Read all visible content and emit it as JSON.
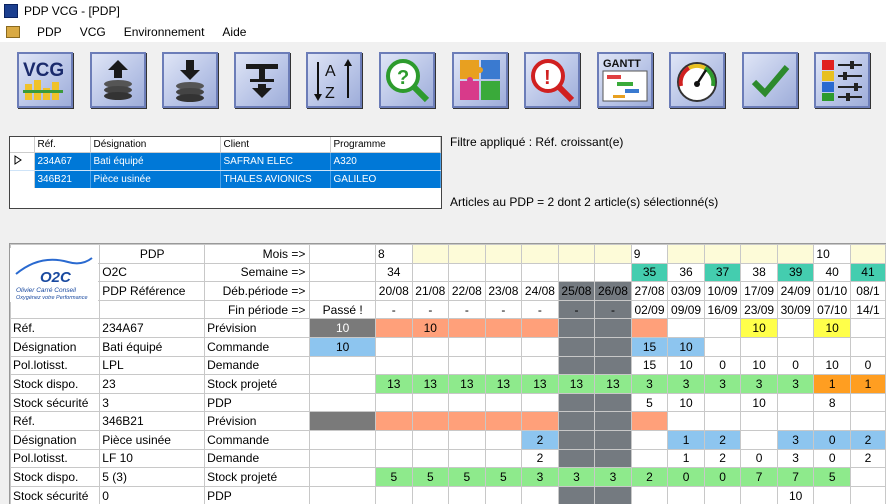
{
  "window": {
    "title": "PDP VCG - [PDP]"
  },
  "menu": [
    "PDP",
    "VCG",
    "Environnement",
    "Aide"
  ],
  "toolbar": [
    {
      "name": "vcg-button",
      "icon": "vcg-logo"
    },
    {
      "name": "stack-up-button",
      "icon": "stack-arrow-up-icon"
    },
    {
      "name": "stack-down-button",
      "icon": "stack-arrow-down-icon"
    },
    {
      "name": "split-arrow-button",
      "icon": "split-arrow-icon"
    },
    {
      "name": "sort-az-button",
      "icon": "sort-az-icon"
    },
    {
      "name": "help-search-button",
      "icon": "question-magnifier-icon"
    },
    {
      "name": "puzzle-button",
      "icon": "puzzle-icon"
    },
    {
      "name": "alert-search-button",
      "icon": "exclamation-magnifier-icon"
    },
    {
      "name": "gantt-button",
      "icon": "gantt-icon",
      "label": "GANTT"
    },
    {
      "name": "gauge-button",
      "icon": "gauge-icon"
    },
    {
      "name": "validate-button",
      "icon": "checkmark-icon"
    },
    {
      "name": "settings-button",
      "icon": "sliders-icon"
    }
  ],
  "articles": {
    "columns": [
      "Réf.",
      "Désignation",
      "Client",
      "Programme"
    ],
    "rows": [
      {
        "ref": "234A67",
        "designation": "Bati équipé",
        "client": "SAFRAN ELEC",
        "programme": "A320"
      },
      {
        "ref": "346B21",
        "designation": "Pièce usinée",
        "client": "THALES AVIONICS",
        "programme": "GALILEO"
      }
    ]
  },
  "filter_label": "Filtre appliqué : Réf. croissant(e)",
  "count_label": "Articles au PDP = 2 dont 2 article(s) sélectionné(s)",
  "logo": {
    "text": "O2C",
    "tagline1": "Olivier Carré Conseil",
    "tagline2": "Oxygénez votre Performance"
  },
  "grid": {
    "head": {
      "pdp": "PDP",
      "o2c": "O2C",
      "pdp_ref": "PDP Référence",
      "mois_lbl": "Mois =>",
      "semaine_lbl": "Semaine =>",
      "deb_lbl": "Déb.période =>",
      "fin_lbl": "Fin période =>",
      "passe": "Passé !",
      "mois": [
        "8",
        "",
        "",
        "",
        "",
        "",
        "",
        "9",
        "",
        "",
        "",
        "",
        "10",
        ""
      ],
      "semaine": [
        "34",
        "",
        "",
        "",
        "",
        "",
        "",
        "35",
        "36",
        "37",
        "38",
        "39",
        "40",
        "41"
      ],
      "deb": [
        "20/08",
        "21/08",
        "22/08",
        "23/08",
        "24/08",
        "25/08",
        "26/08",
        "27/08",
        "03/09",
        "10/09",
        "17/09",
        "24/09",
        "01/10",
        "08/1"
      ],
      "fin": [
        "-",
        "-",
        "-",
        "-",
        "-",
        "-",
        "-",
        "02/09",
        "09/09",
        "16/09",
        "23/09",
        "30/09",
        "07/10",
        "14/1"
      ]
    },
    "articles": [
      {
        "ref_lbl": "Réf.",
        "ref": "234A67",
        "desig_lbl": "Désignation",
        "desig": "Bati équipé",
        "pol_lbl": "Pol.lotisst.",
        "pol": "LPL",
        "stock_lbl": "Stock dispo.",
        "stock": "23",
        "secu_lbl": "Stock sécurité",
        "secu": "3",
        "prevision_lbl": "Prévision",
        "commande_lbl": "Commande",
        "demande_lbl": "Demande",
        "projete_lbl": "Stock projeté",
        "pdp_lbl": "PDP",
        "prevision": {
          "passe": "10",
          "v": [
            "",
            "10",
            "",
            "",
            "",
            "",
            "",
            "",
            "",
            "",
            "10",
            "",
            "10",
            ""
          ]
        },
        "commande": {
          "passe": "10",
          "v": [
            "",
            "",
            "",
            "",
            "",
            "",
            "",
            "15",
            "10",
            "",
            "",
            "",
            "",
            ""
          ]
        },
        "demande": {
          "passe": "",
          "v": [
            "",
            "",
            "",
            "",
            "",
            "",
            "",
            "15",
            "10",
            "0",
            "10",
            "0",
            "10",
            "0"
          ]
        },
        "projete": {
          "passe": "",
          "v": [
            "13",
            "13",
            "13",
            "13",
            "13",
            "13",
            "13",
            "3",
            "3",
            "3",
            "3",
            "3",
            "1",
            "1"
          ]
        },
        "pdp": {
          "passe": "",
          "v": [
            "",
            "",
            "",
            "",
            "",
            "",
            "",
            "5",
            "10",
            "",
            "10",
            "",
            "8",
            ""
          ]
        }
      },
      {
        "ref_lbl": "Réf.",
        "ref": "346B21",
        "desig_lbl": "Désignation",
        "desig": "Pièce usinée",
        "pol_lbl": "Pol.lotisst.",
        "pol": "LF 10",
        "stock_lbl": "Stock dispo.",
        "stock": "5 (3)",
        "secu_lbl": "Stock sécurité",
        "secu": "0",
        "prevision_lbl": "Prévision",
        "commande_lbl": "Commande",
        "demande_lbl": "Demande",
        "projete_lbl": "Stock projeté",
        "pdp_lbl": "PDP",
        "prevision": {
          "passe": "",
          "v": [
            "",
            "",
            "",
            "",
            "",
            "",
            "",
            "",
            "",
            "",
            "",
            "",
            "",
            ""
          ]
        },
        "commande": {
          "passe": "",
          "v": [
            "",
            "",
            "",
            "",
            "2",
            "",
            "",
            "",
            "1",
            "2",
            "",
            "3",
            "0",
            "2"
          ]
        },
        "demande": {
          "passe": "",
          "v": [
            "",
            "",
            "",
            "",
            "2",
            "",
            "",
            "",
            "1",
            "2",
            "0",
            "3",
            "0",
            "2"
          ]
        },
        "projete": {
          "passe": "",
          "v": [
            "5",
            "5",
            "5",
            "5",
            "3",
            "3",
            "3",
            "2",
            "0",
            "0",
            "7",
            "7",
            "5",
            ""
          ]
        },
        "pdp": {
          "passe": "",
          "v": [
            "",
            "",
            "",
            "",
            "",
            "",
            "",
            "",
            "",
            "",
            "",
            "10",
            "",
            ""
          ]
        }
      }
    ]
  },
  "colors": {
    "selection": "#0078d7",
    "prevision": "#ffa07a",
    "projete": "#8eea8c",
    "week_teal": "#44cdaf",
    "commande": "#8dc5ef",
    "highlight": "#ffff4a",
    "weekend": "#747a80"
  }
}
